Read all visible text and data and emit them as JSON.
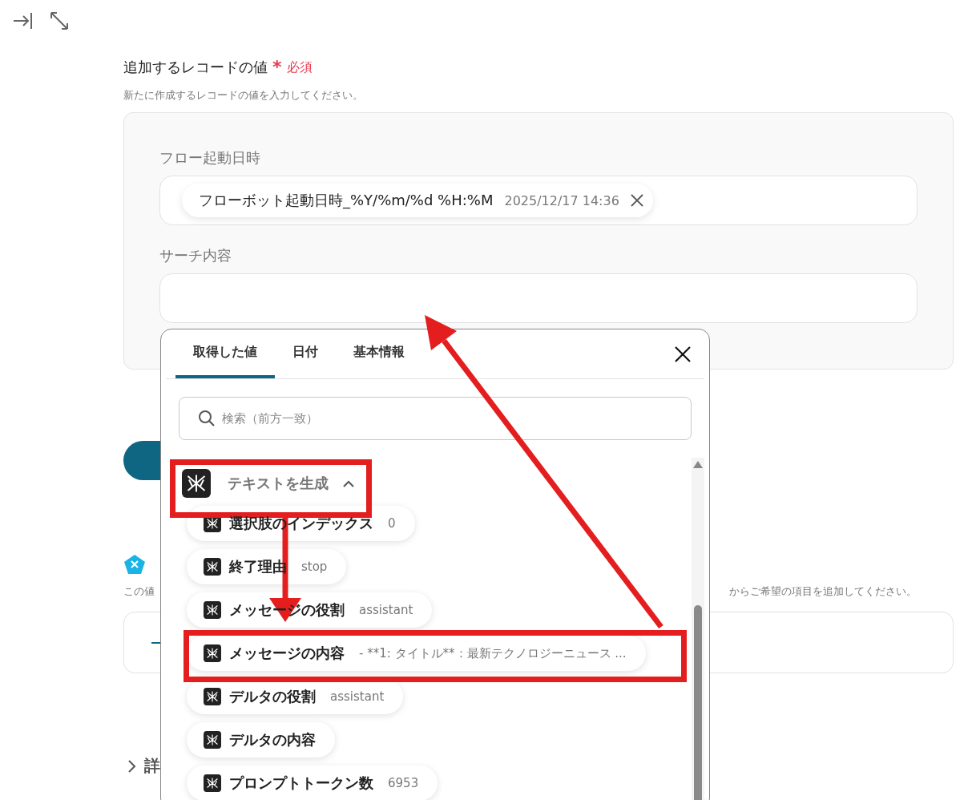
{
  "record_values": {
    "title": "追加するレコードの値",
    "required_mark": "*",
    "required": "必須",
    "description": "新たに作成するレコードの値を入力してください。",
    "fields": [
      {
        "label": "フロー起動日時",
        "tokens": [
          {
            "name": "フローボット起動日時_%Y/%m/%d %H:%M",
            "value": "2025/12/17 14:36"
          }
        ]
      },
      {
        "label": "サーチ内容"
      }
    ]
  },
  "extra_section": {
    "description_start": "この値",
    "description_end": "からご希望の項目を追加してください。"
  },
  "details": {
    "label": "詳"
  },
  "picker": {
    "tabs": [
      {
        "label": "取得した値",
        "selected": true
      },
      {
        "label": "日付",
        "selected": false
      },
      {
        "label": "基本情報",
        "selected": false
      }
    ],
    "search": {
      "placeholder": "検索（前方一致）"
    },
    "group": {
      "title": "テキストを生成",
      "expanded": true,
      "items": [
        {
          "label": "選択肢のインデックス",
          "value": "0"
        },
        {
          "label": "終了理由",
          "value": "stop"
        },
        {
          "label": "メッセージの役割",
          "value": "assistant"
        },
        {
          "label": "メッセージの内容",
          "value": "- **1: タイトル**：最新テクノロジーニュース ..."
        },
        {
          "label": "デルタの役割",
          "value": "assistant"
        },
        {
          "label": "デルタの内容"
        },
        {
          "label": "プロンプトトークン数",
          "value": "6953"
        }
      ]
    }
  }
}
